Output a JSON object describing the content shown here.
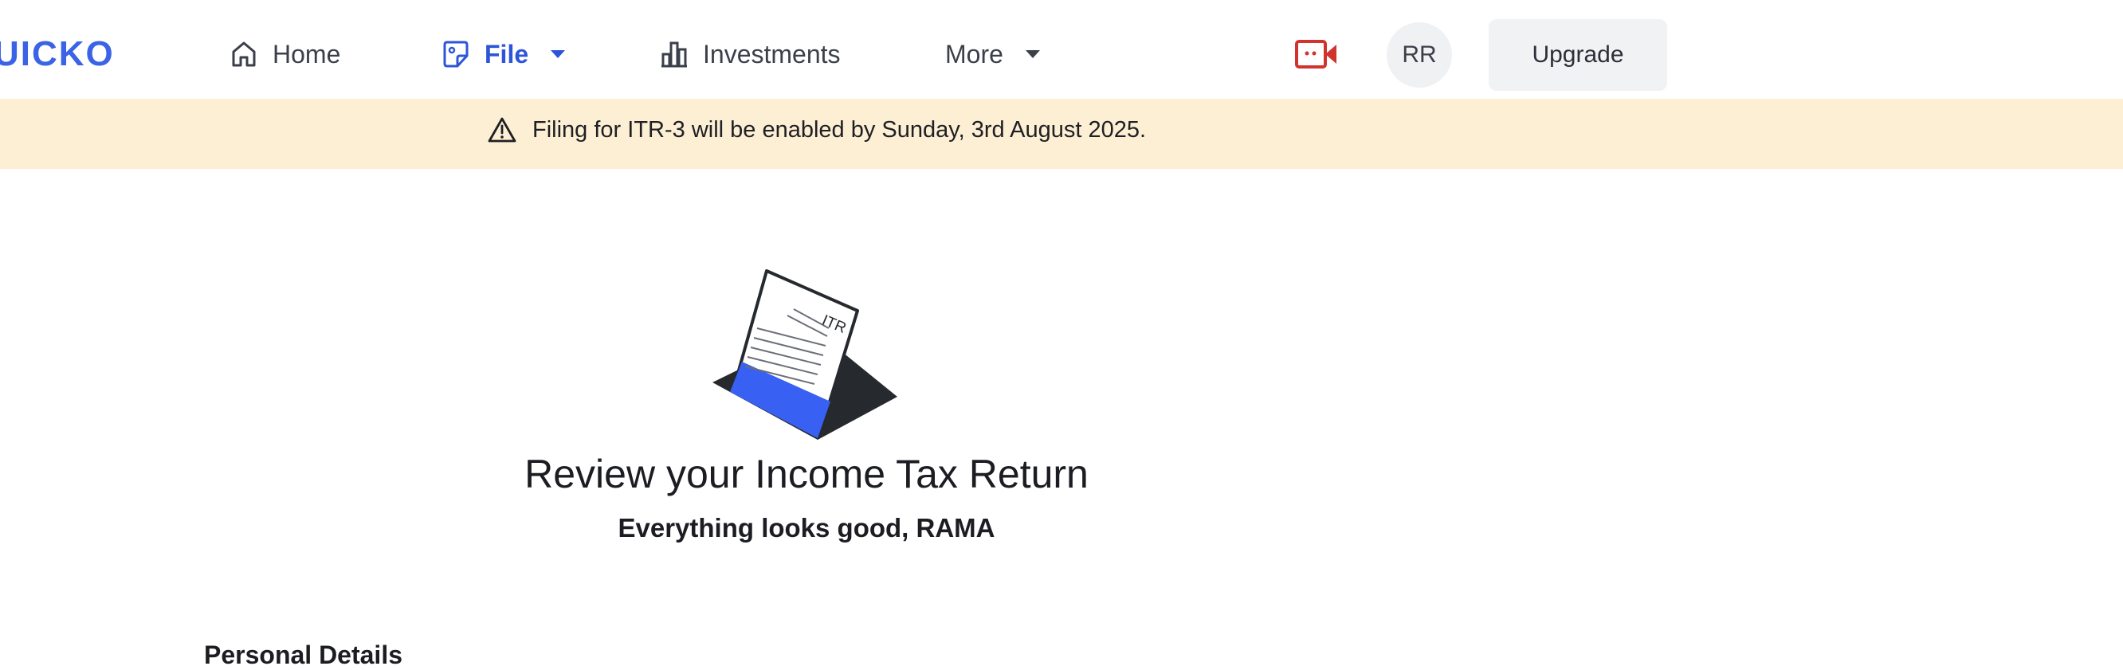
{
  "brand": {
    "logo_text": "UICKO",
    "accent_color": "#3b63e6"
  },
  "nav": {
    "home": {
      "label": "Home",
      "icon": "home-icon"
    },
    "file": {
      "label": "File",
      "icon": "file-sticker-icon",
      "active": true
    },
    "investments": {
      "label": "Investments",
      "icon": "bar-chart-icon"
    },
    "more": {
      "label": "More",
      "icon": "chevron-down-icon"
    }
  },
  "header_actions": {
    "video_icon": "video-call-icon",
    "video_color": "#d0342c",
    "avatar_initials": "RR",
    "upgrade_label": "Upgrade"
  },
  "banner": {
    "icon": "warning-icon",
    "text": "Filing for ITR-3 will be enabled by Sunday, 3rd August 2025.",
    "background": "#fcefd4"
  },
  "main": {
    "illustration_label": "ITR",
    "title": "Review your Income Tax Return",
    "subtitle": "Everything looks good, RAMA",
    "section_title": "Personal Details"
  }
}
